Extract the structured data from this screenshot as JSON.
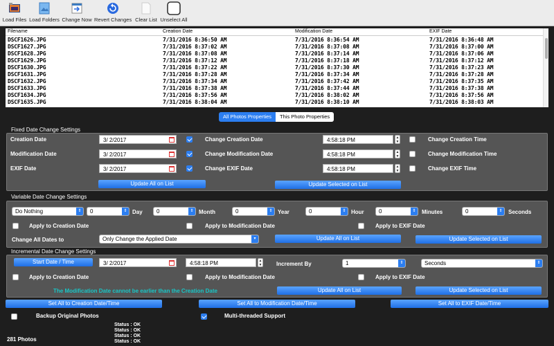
{
  "toolbar": {
    "items": [
      {
        "label": "Load Files",
        "icon": "load-files-icon"
      },
      {
        "label": "Load Folders",
        "icon": "load-folders-icon"
      },
      {
        "label": "Change Now",
        "icon": "change-now-icon"
      },
      {
        "label": "Revert Changes",
        "icon": "revert-changes-icon"
      },
      {
        "label": "Clear List",
        "icon": "clear-list-icon"
      },
      {
        "label": "Unselect All",
        "icon": "unselect-all-icon"
      }
    ]
  },
  "table": {
    "headers": [
      "Filename",
      "Creation Date",
      "Modification Date",
      "EXIF Date"
    ],
    "rows": [
      [
        "DSCF1626.JPG",
        "7/31/2016 8:36:50 AM",
        "7/31/2016 8:36:54 AM",
        "7/31/2016 8:36:48 AM"
      ],
      [
        "DSCF1627.JPG",
        "7/31/2016 8:37:02 AM",
        "7/31/2016 8:37:08 AM",
        "7/31/2016 8:37:00 AM"
      ],
      [
        "DSCF1628.JPG",
        "7/31/2016 8:37:08 AM",
        "7/31/2016 8:37:14 AM",
        "7/31/2016 8:37:06 AM"
      ],
      [
        "DSCF1629.JPG",
        "7/31/2016 8:37:12 AM",
        "7/31/2016 8:37:18 AM",
        "7/31/2016 8:37:12 AM"
      ],
      [
        "DSCF1630.JPG",
        "7/31/2016 8:37:22 AM",
        "7/31/2016 8:37:30 AM",
        "7/31/2016 8:37:23 AM"
      ],
      [
        "DSCF1631.JPG",
        "7/31/2016 8:37:28 AM",
        "7/31/2016 8:37:34 AM",
        "7/31/2016 8:37:28 AM"
      ],
      [
        "DSCF1632.JPG",
        "7/31/2016 8:37:34 AM",
        "7/31/2016 8:37:42 AM",
        "7/31/2016 8:37:35 AM"
      ],
      [
        "DSCF1633.JPG",
        "7/31/2016 8:37:38 AM",
        "7/31/2016 8:37:44 AM",
        "7/31/2016 8:37:38 AM"
      ],
      [
        "DSCF1634.JPG",
        "7/31/2016 8:37:56 AM",
        "7/31/2016 8:38:02 AM",
        "7/31/2016 8:37:56 AM"
      ],
      [
        "DSCF1635.JPG",
        "7/31/2016 8:38:04 AM",
        "7/31/2016 8:38:10 AM",
        "7/31/2016 8:38:03 AM"
      ]
    ]
  },
  "tabs": {
    "all": "All Photos Properties",
    "this": "This Photo Properties"
  },
  "fixed": {
    "title": "Fixed Date Change Settings",
    "creation_label": "Creation Date",
    "modification_label": "Modification Date",
    "exif_label": "EXIF Date",
    "creation_date": "3/  2/2017",
    "modification_date": "3/  2/2017",
    "exif_date": "3/  2/2017",
    "change_creation_date": "Change Creation Date",
    "change_modification_date": "Change Modification Date",
    "change_exif_date": "Change EXIF Date",
    "creation_time": "4:58:18 PM",
    "modification_time": "4:58:18 PM",
    "exif_time": "4:58:18 PM",
    "change_creation_time": "Change Creation Time",
    "change_modification_time": "Change Modification Time",
    "change_exif_time": "Change EXIF Time",
    "update_all": "Update All on List",
    "update_selected": "Update Selected on List"
  },
  "variable": {
    "title": "Variable Date Change Settings",
    "mode": "Do Nothing",
    "day_value": "0",
    "day": "Day",
    "month_value": "0",
    "month": "Month",
    "year_value": "0",
    "year": "Year",
    "hour_value": "0",
    "hour": "Hour",
    "minutes_value": "0",
    "minutes": "Minutes",
    "seconds_value": "0",
    "seconds": "Seconds",
    "apply_creation": "Apply to Creation Date",
    "apply_modification": "Apply to Modification Date",
    "apply_exif": "Apply to EXIF Date",
    "change_all_label": "Change All Dates to",
    "change_all_value": "Only Change the Applied Date",
    "update_all": "Update All on List",
    "update_selected": "Update Selected on List"
  },
  "incremental": {
    "title": "Incremental Date Change Settings",
    "start_button": "Start Date / Time",
    "date": "3/  2/2017",
    "time": "4:58:18 PM",
    "increment_by": "Increment By",
    "increment_value": "1",
    "unit": "Seconds",
    "apply_creation": "Apply to Creation Date",
    "apply_modification": "Apply to Modification Date",
    "apply_exif": "Apply to EXIF Date",
    "note": "The Modification Date cannot be earlier than the Creation Date",
    "update_all": "Update All on List",
    "update_selected": "Update Selected on List"
  },
  "bottom": {
    "set_creation": "Set All to Creation Date/Time",
    "set_modification": "Set All to Modification Date/Time",
    "set_exif": "Set All to EXIF Date/Time",
    "backup": "Backup Original Photos",
    "multithread": "Multi-threaded Support",
    "status_lines": [
      "Status : OK",
      "Status : OK",
      "Status : OK",
      "Status : OK"
    ],
    "photo_count": "281 Photos"
  },
  "colors": {
    "accent": "#2c7ef0",
    "note": "#18c6c6",
    "panel": "#555555",
    "background": "#1e1e1e"
  }
}
